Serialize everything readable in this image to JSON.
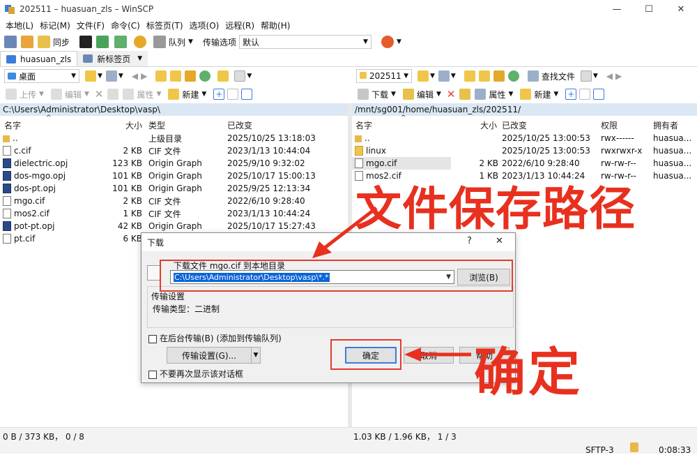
{
  "window": {
    "title": "202511 – huasuan_zls – WinSCP",
    "controls": [
      "—",
      "☐",
      "✕"
    ]
  },
  "menu": [
    "本地(L)",
    "标记(M)",
    "文件(F)",
    "命令(C)",
    "标签页(T)",
    "选项(O)",
    "远程(R)",
    "帮助(H)"
  ],
  "toolbar": {
    "sync": "同步",
    "queue": "队列",
    "transfer_options": "传输选项",
    "transfer_value": "默认"
  },
  "tabs": [
    {
      "label": "huasuan_zls"
    },
    {
      "label": "新标签页"
    }
  ],
  "local": {
    "drive": "桌面",
    "actions": {
      "upload": "上传",
      "edit": "编辑",
      "props": "属性",
      "new": "新建"
    },
    "path": "C:\\Users\\Administrator\\Desktop\\vasp\\",
    "headers": {
      "name": "名字",
      "size": "大小",
      "type": "类型",
      "modified": "已改变"
    },
    "files": [
      {
        "name": "..",
        "size": "",
        "type": "上级目录",
        "modified": "2025/10/25 13:18:03",
        "icon": "up"
      },
      {
        "name": "c.cif",
        "size": "2 KB",
        "type": "CIF 文件",
        "modified": "2023/1/13 10:44:04",
        "icon": "file"
      },
      {
        "name": "dielectric.opj",
        "size": "123 KB",
        "type": "Origin Graph",
        "modified": "2025/9/10 9:32:02",
        "icon": "opj"
      },
      {
        "name": "dos-mgo.opj",
        "size": "101 KB",
        "type": "Origin Graph",
        "modified": "2025/10/17 15:00:13",
        "icon": "opj"
      },
      {
        "name": "dos-pt.opj",
        "size": "101 KB",
        "type": "Origin Graph",
        "modified": "2025/9/25 12:13:34",
        "icon": "opj"
      },
      {
        "name": "mgo.cif",
        "size": "2 KB",
        "type": "CIF 文件",
        "modified": "2022/6/10 9:28:40",
        "icon": "file"
      },
      {
        "name": "mos2.cif",
        "size": "1 KB",
        "type": "CIF 文件",
        "modified": "2023/1/13 10:44:24",
        "icon": "file"
      },
      {
        "name": "pot-pt.opj",
        "size": "42 KB",
        "type": "Origin Graph",
        "modified": "2025/10/17 15:27:43",
        "icon": "opj"
      },
      {
        "name": "pt.cif",
        "size": "6 KB",
        "type": "",
        "modified": "",
        "icon": "file"
      }
    ],
    "status": "0 B / 373 KB，  0 / 8"
  },
  "remote": {
    "dir": "202511",
    "find": "查找文件",
    "actions": {
      "download": "下载",
      "edit": "编辑",
      "props": "属性",
      "new": "新建"
    },
    "path": "/mnt/sg001/home/huasuan_zls/202511/",
    "headers": {
      "name": "名字",
      "size": "大小",
      "modified": "已改变",
      "perms": "权限",
      "owner": "拥有者"
    },
    "files": [
      {
        "name": "..",
        "size": "",
        "modified": "2025/10/25 13:00:53",
        "perms": "rwx------",
        "owner": "huasua...",
        "icon": "up"
      },
      {
        "name": "linux",
        "size": "",
        "modified": "2025/10/25 13:00:53",
        "perms": "rwxrwxr-x",
        "owner": "huasua...",
        "icon": "folder"
      },
      {
        "name": "mgo.cif",
        "size": "2 KB",
        "modified": "2022/6/10 9:28:40",
        "perms": "rw-rw-r--",
        "owner": "huasua...",
        "icon": "file"
      },
      {
        "name": "mos2.cif",
        "size": "1 KB",
        "modified": "2023/1/13 10:44:24",
        "perms": "rw-rw-r--",
        "owner": "huasua...",
        "icon": "file"
      }
    ],
    "status": "1.03 KB / 1.96 KB，  1 / 3"
  },
  "statusbar": {
    "protocol": "SFTP-3",
    "time": "0:08:33"
  },
  "dialog": {
    "title": "下载",
    "help": "?",
    "close": "✕",
    "prompt": "下载文件 mgo.cif 到本地目录",
    "target": "C:\\Users\\Administrator\\Desktop\\vasp\\*.*",
    "browse": "浏览(B)",
    "transfer_settings_heading": "传输设置",
    "transfer_type": "传输类型：二进制",
    "background": "在后台传输(B) (添加到传输队列)",
    "settings_button": "传输设置(G)...",
    "dont_show": "不要再次显示该对话框",
    "ok": "确定",
    "cancel": "取消",
    "help_btn": "帮助"
  },
  "annotations": {
    "path_label": "文件保存路径",
    "confirm_label": "确定"
  },
  "colors": {
    "annotation_red": "#e8301f",
    "path_bar": "#dbe8f3",
    "selection": "#0a64d8"
  }
}
